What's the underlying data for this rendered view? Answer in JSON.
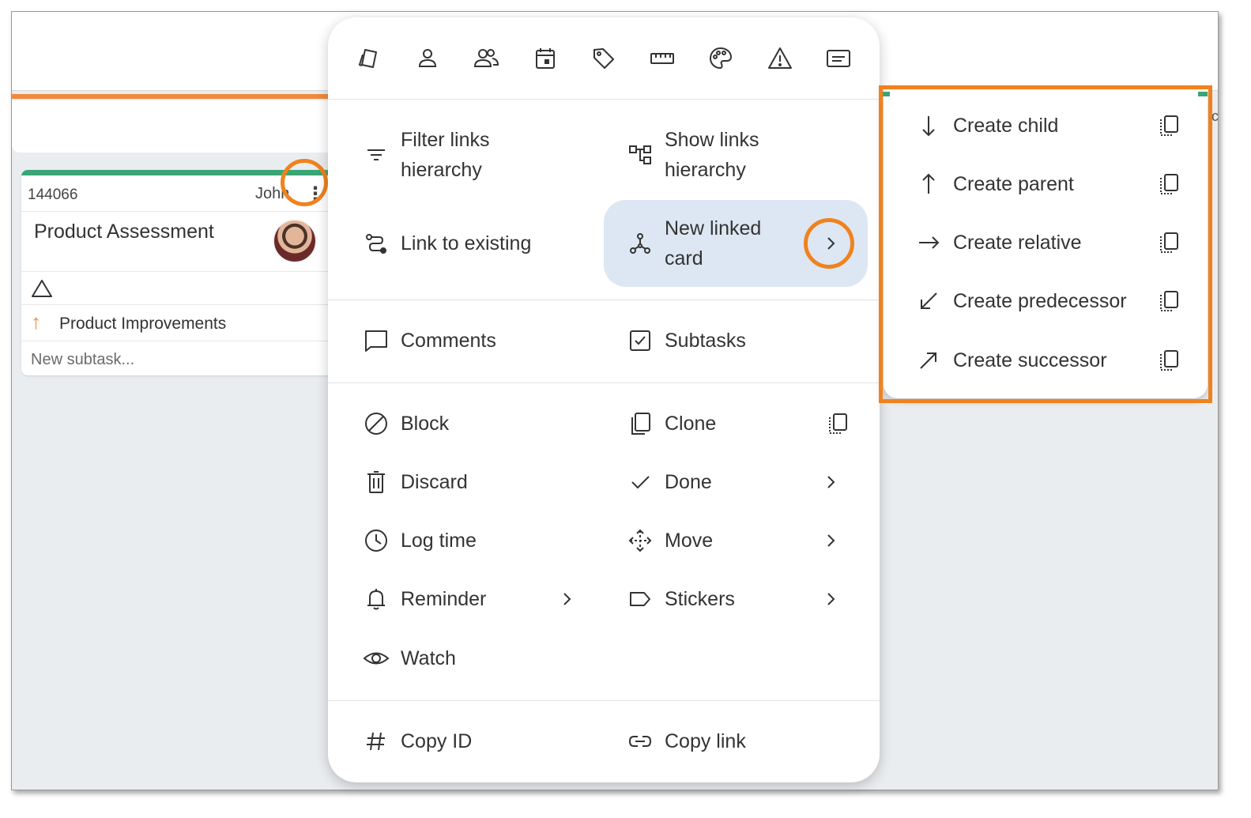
{
  "card": {
    "id": "144066",
    "owner": "John",
    "title": "Product Assessment",
    "parent_link": "Product Improvements",
    "subtask_placeholder": "New subtask..."
  },
  "background": {
    "right_edge_char": "c"
  },
  "toolbar_icons": [
    "card-type-icon",
    "user-icon",
    "users-icon",
    "calendar-icon",
    "tag-icon",
    "ruler-icon",
    "palette-icon",
    "warning-icon",
    "card-template-icon"
  ],
  "menu": {
    "filter_links": [
      "Filter links",
      "hierarchy"
    ],
    "show_links": [
      "Show links",
      "hierarchy"
    ],
    "link_to_existing": "Link to existing",
    "new_linked_card": [
      "New linked",
      "card"
    ],
    "comments": "Comments",
    "subtasks": "Subtasks",
    "block": "Block",
    "clone": "Clone",
    "discard": "Discard",
    "done": "Done",
    "log_time": "Log time",
    "move": "Move",
    "reminder": "Reminder",
    "stickers": "Stickers",
    "watch": "Watch",
    "copy_id": "Copy ID",
    "copy_link": "Copy link"
  },
  "submenu": {
    "items": [
      {
        "label": "Create child",
        "icon": "arrow-down-icon"
      },
      {
        "label": "Create parent",
        "icon": "arrow-up-icon"
      },
      {
        "label": "Create relative",
        "icon": "arrow-right-icon"
      },
      {
        "label": "Create predecessor",
        "icon": "arrow-down-left-icon"
      },
      {
        "label": "Create successor",
        "icon": "arrow-up-right-icon"
      }
    ]
  },
  "colors": {
    "highlight": "#f0821e",
    "accent_green": "#3aa575",
    "selected_item_bg": "#dde7f3",
    "parent_arrow": "#f08a3c"
  }
}
